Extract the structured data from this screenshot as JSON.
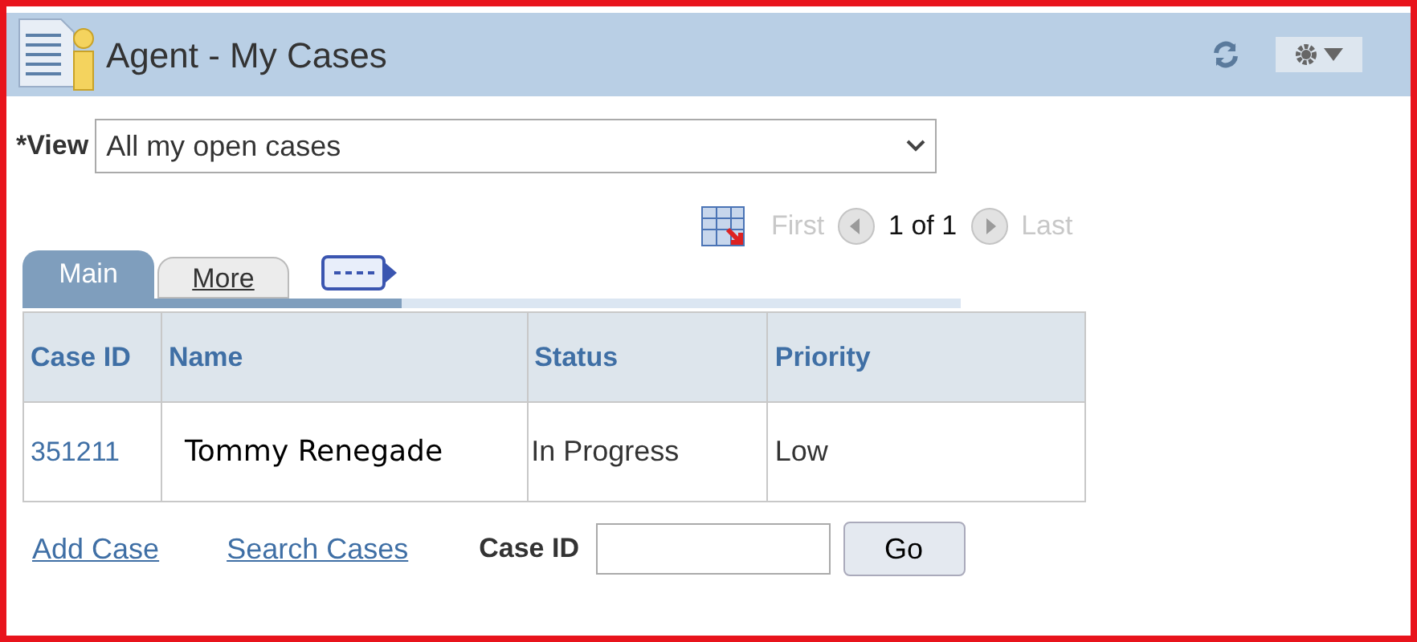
{
  "header": {
    "title": "Agent - My Cases"
  },
  "view": {
    "label": "*View",
    "value": "All my open cases"
  },
  "pager": {
    "first": "First",
    "count": "1 of 1",
    "last": "Last"
  },
  "tabs": [
    {
      "label": "Main",
      "selected": true
    },
    {
      "label": "More",
      "selected": false
    }
  ],
  "table": {
    "columns": [
      "Case ID",
      "Name",
      "Status",
      "Priority"
    ],
    "rows": [
      {
        "case_id": "351211",
        "name": "Tommy Renegade",
        "status": "In Progress",
        "priority": "Low"
      }
    ]
  },
  "footer": {
    "links": [
      "Add Case",
      "Search Cases"
    ],
    "case_id_label": "Case ID",
    "go": "Go"
  }
}
